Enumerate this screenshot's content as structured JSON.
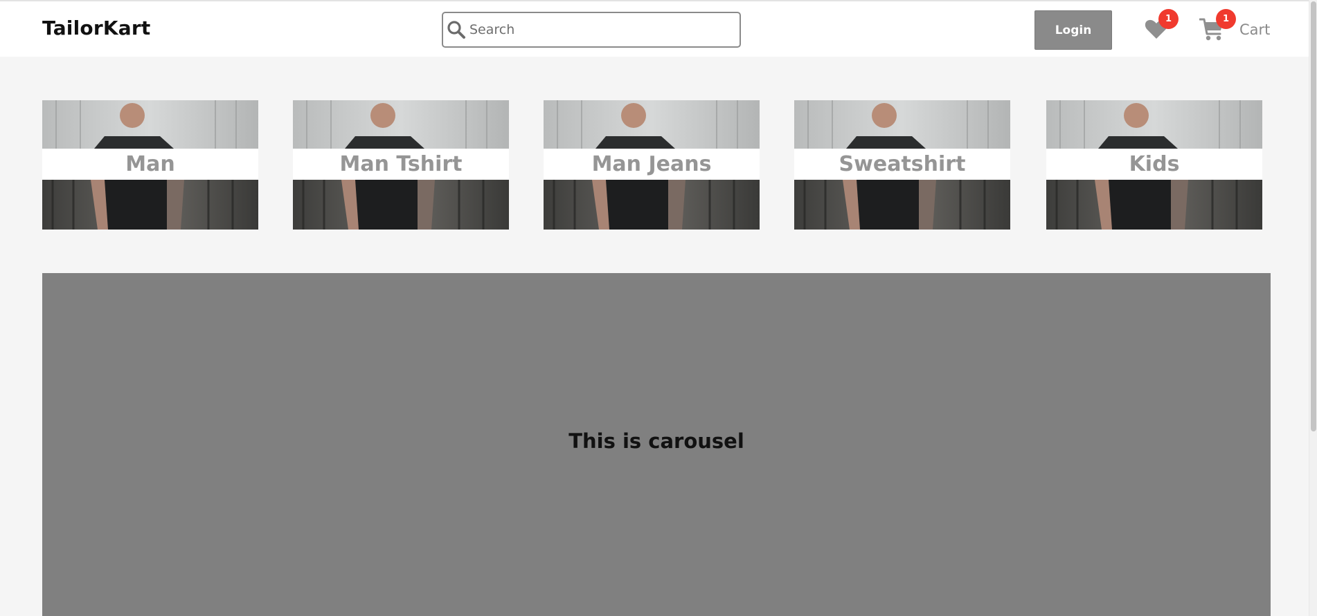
{
  "header": {
    "brand": "TailorKart",
    "search": {
      "placeholder": "Search",
      "value": ""
    },
    "login_label": "Login",
    "wishlist": {
      "icon": "heart-icon",
      "count": "1"
    },
    "cart": {
      "icon": "cart-icon",
      "label": "Cart",
      "count": "1"
    }
  },
  "categories": [
    {
      "label": "Man"
    },
    {
      "label": "Man Tshirt"
    },
    {
      "label": "Man Jeans"
    },
    {
      "label": "Sweatshirt"
    },
    {
      "label": "Kids"
    }
  ],
  "carousel": {
    "caption": "This is carousel"
  },
  "colors": {
    "page_bg": "#f5f5f5",
    "header_bg": "#ffffff",
    "button_gray": "#8a8a8a",
    "badge_red": "#f03a2e",
    "carousel_bg": "#808080"
  }
}
